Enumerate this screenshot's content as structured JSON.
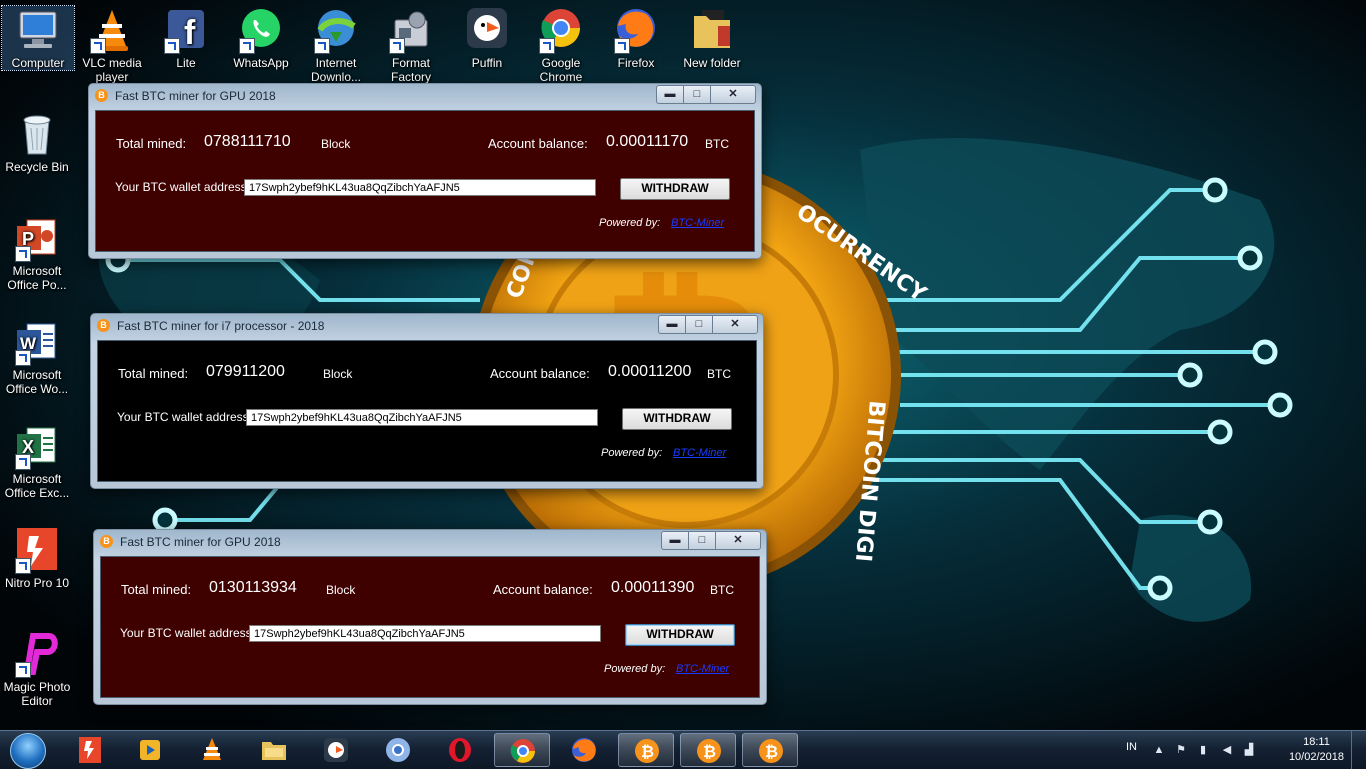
{
  "desktop": {
    "top_icons": [
      {
        "label": "Computer"
      },
      {
        "label": "VLC media player"
      },
      {
        "label": "Lite"
      },
      {
        "label": "WhatsApp"
      },
      {
        "label": "Internet Downlo..."
      },
      {
        "label": "Format Factory"
      },
      {
        "label": "Puffin"
      },
      {
        "label": "Google Chrome"
      },
      {
        "label": "Firefox"
      },
      {
        "label": "New folder"
      }
    ],
    "left_icons": [
      {
        "label": "Recycle Bin"
      },
      {
        "label": "Microsoft Office Po..."
      },
      {
        "label": "Microsoft Office Wo..."
      },
      {
        "label": "Microsoft Office Exc..."
      },
      {
        "label": "Nitro Pro 10"
      },
      {
        "label": "Magic Photo Editor"
      }
    ]
  },
  "windows": [
    {
      "title": "Fast BTC miner for GPU 2018",
      "theme": "#3f0000",
      "total_mined_label": "Total mined:",
      "total_mined": "0788111710",
      "block_label": "Block",
      "balance_label": "Account balance:",
      "balance": "0.00011170",
      "currency": "BTC",
      "wallet_label": "Your BTC wallet address:",
      "wallet": "17Swph2ybef9hKL43ua8QqZibchYaAFJN5",
      "withdraw_label": "WITHDRAW",
      "powered_label": "Powered by:",
      "powered_link": "BTC-Miner"
    },
    {
      "title": "Fast BTC miner for i7 processor - 2018",
      "theme": "#000000",
      "total_mined_label": "Total mined:",
      "total_mined": "079911200",
      "block_label": "Block",
      "balance_label": "Account balance:",
      "balance": "0.00011200",
      "currency": "BTC",
      "wallet_label": "Your BTC wallet address:",
      "wallet": "17Swph2ybef9hKL43ua8QqZibchYaAFJN5",
      "withdraw_label": "WITHDRAW",
      "powered_label": "Powered by:",
      "powered_link": "BTC-Miner"
    },
    {
      "title": "Fast BTC miner for GPU 2018",
      "theme": "#3f0000",
      "total_mined_label": "Total mined:",
      "total_mined": "0130113934",
      "block_label": "Block",
      "balance_label": "Account balance:",
      "balance": "0.00011390",
      "currency": "BTC",
      "wallet_label": "Your BTC wallet address:",
      "wallet": "17Swph2ybef9hKL43ua8QqZibchYaAFJN5",
      "withdraw_label": "WITHDRAW",
      "powered_label": "Powered by:",
      "powered_link": "BTC-Miner"
    }
  ],
  "window_controls": {
    "minimize": "▬",
    "maximize": "□",
    "close": "✕"
  },
  "wallpaper_text": {
    "coin_top": "OCURRENCY",
    "coin_right": "BITCOIN DIGI",
    "coin_left": "COIN"
  },
  "taskbar": {
    "items": [
      "nitro-pdf-icon",
      "media-player-icon",
      "vlc-icon",
      "explorer-icon",
      "puffin-icon",
      "chromium-icon",
      "opera-icon",
      "chrome-icon",
      "firefox-icon",
      "bitcoin-icon",
      "bitcoin-icon",
      "bitcoin-icon"
    ],
    "language": "IN",
    "time": "18:11",
    "date": "10/02/2018"
  },
  "colors": {
    "accent_bitcoin": "#f7931a",
    "window_red": "#3f0000",
    "link": "#1a3cff",
    "glow": "#39e6ff"
  }
}
